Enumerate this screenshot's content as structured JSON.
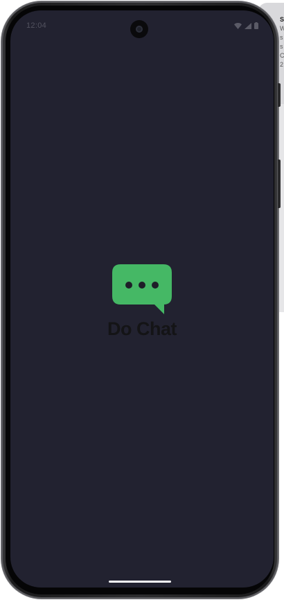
{
  "status_bar": {
    "time": "12:04",
    "icons": [
      "wifi-icon",
      "signal-icon",
      "battery-icon"
    ]
  },
  "splash": {
    "app_name": "Do Chat",
    "logo_icon": "chat-bubble-dots-icon"
  },
  "side_panel": {
    "lines": [
      "STO",
      "W",
      "",
      "s",
      "s",
      "C",
      "2"
    ]
  },
  "colors": {
    "screen_background": "#222230",
    "logo_green": "#45b865",
    "logo_dots": "#1e1e28",
    "app_name_text": "#141416",
    "home_indicator": "#ffffff"
  }
}
